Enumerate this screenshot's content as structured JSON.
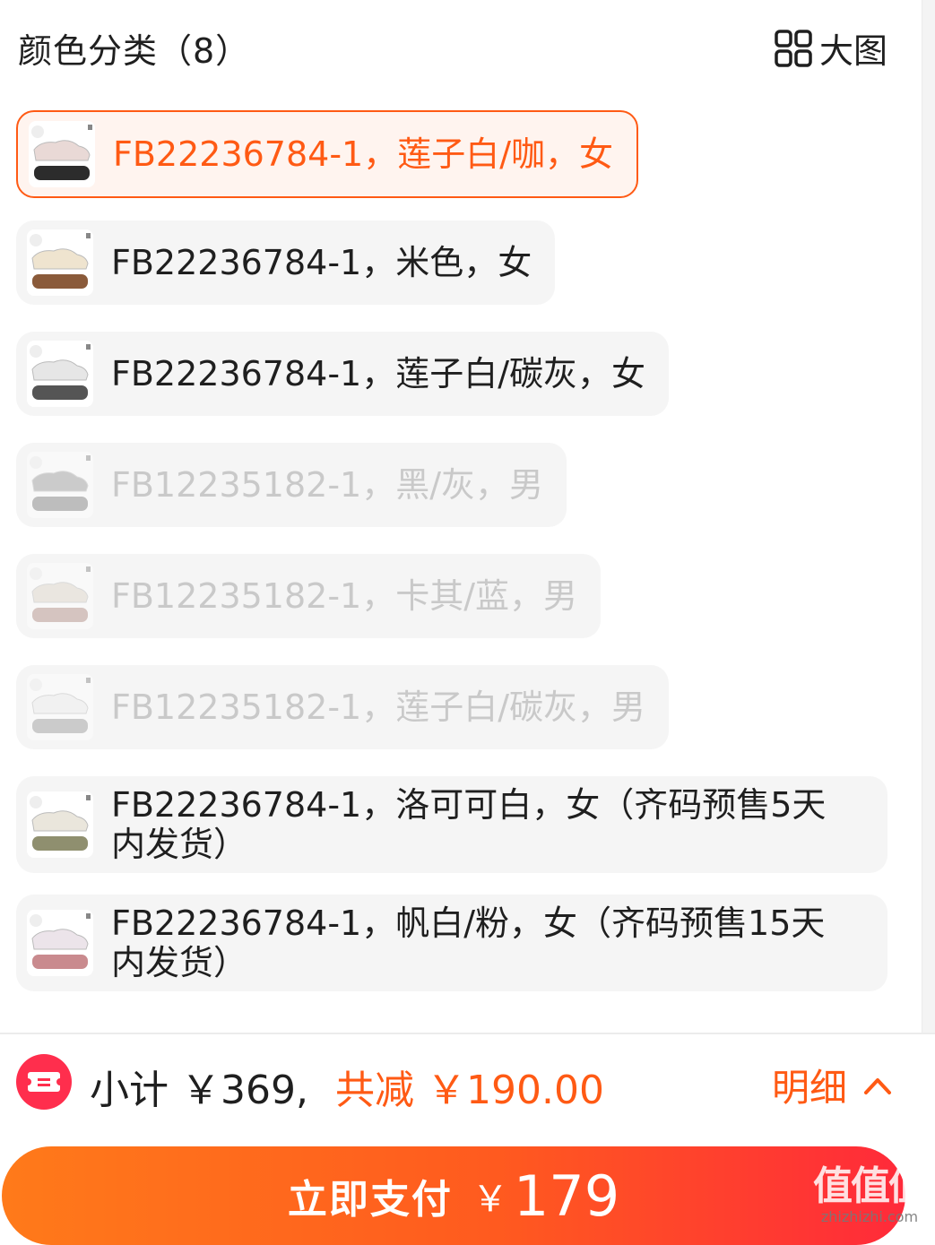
{
  "header": {
    "title": "颜色分类（8）",
    "big_view_label": "大图"
  },
  "options": [
    {
      "label": "FB22236784-1，莲子白/咖，女",
      "state": "selected",
      "shoe_color": "#e9d9d6",
      "sole_color": "#2c2c2c"
    },
    {
      "label": "FB22236784-1，米色，女",
      "state": "normal",
      "shoe_color": "#efe4cf",
      "sole_color": "#8a5a3a"
    },
    {
      "label": "FB22236784-1，莲子白/碳灰，女",
      "state": "normal",
      "shoe_color": "#e6e6e6",
      "sole_color": "#555555"
    },
    {
      "label": "FB12235182-1，黑/灰，男",
      "state": "disabled",
      "shoe_color": "#9a9a9a",
      "sole_color": "#7a7a7a"
    },
    {
      "label": "FB12235182-1，卡其/蓝，男",
      "state": "disabled",
      "shoe_color": "#ddd6c8",
      "sole_color": "#b08a82"
    },
    {
      "label": "FB12235182-1，莲子白/碳灰，男",
      "state": "disabled",
      "shoe_color": "#eeeeee",
      "sole_color": "#9a9a9a"
    },
    {
      "label": "FB22236784-1，洛可可白，女（齐码预售5天内发货）",
      "state": "normal",
      "shoe_color": "#eae6dc",
      "sole_color": "#8f8f6f"
    },
    {
      "label": "FB22236784-1，帆白/粉，女（齐码预售15天内发货）",
      "state": "normal",
      "shoe_color": "#ece4ea",
      "sole_color": "#c98a8e"
    }
  ],
  "summary": {
    "subtotal": "小计 ￥369,",
    "discount": "共减 ￥190.00",
    "detail_label": "明细"
  },
  "pay": {
    "label": "立即支付",
    "currency": "￥",
    "amount": "179"
  },
  "watermark": {
    "logo": "值值值",
    "url": "zhizhizhi.com"
  },
  "colors": {
    "accent": "#ff5a14",
    "coupon": "#ff2e4d"
  }
}
